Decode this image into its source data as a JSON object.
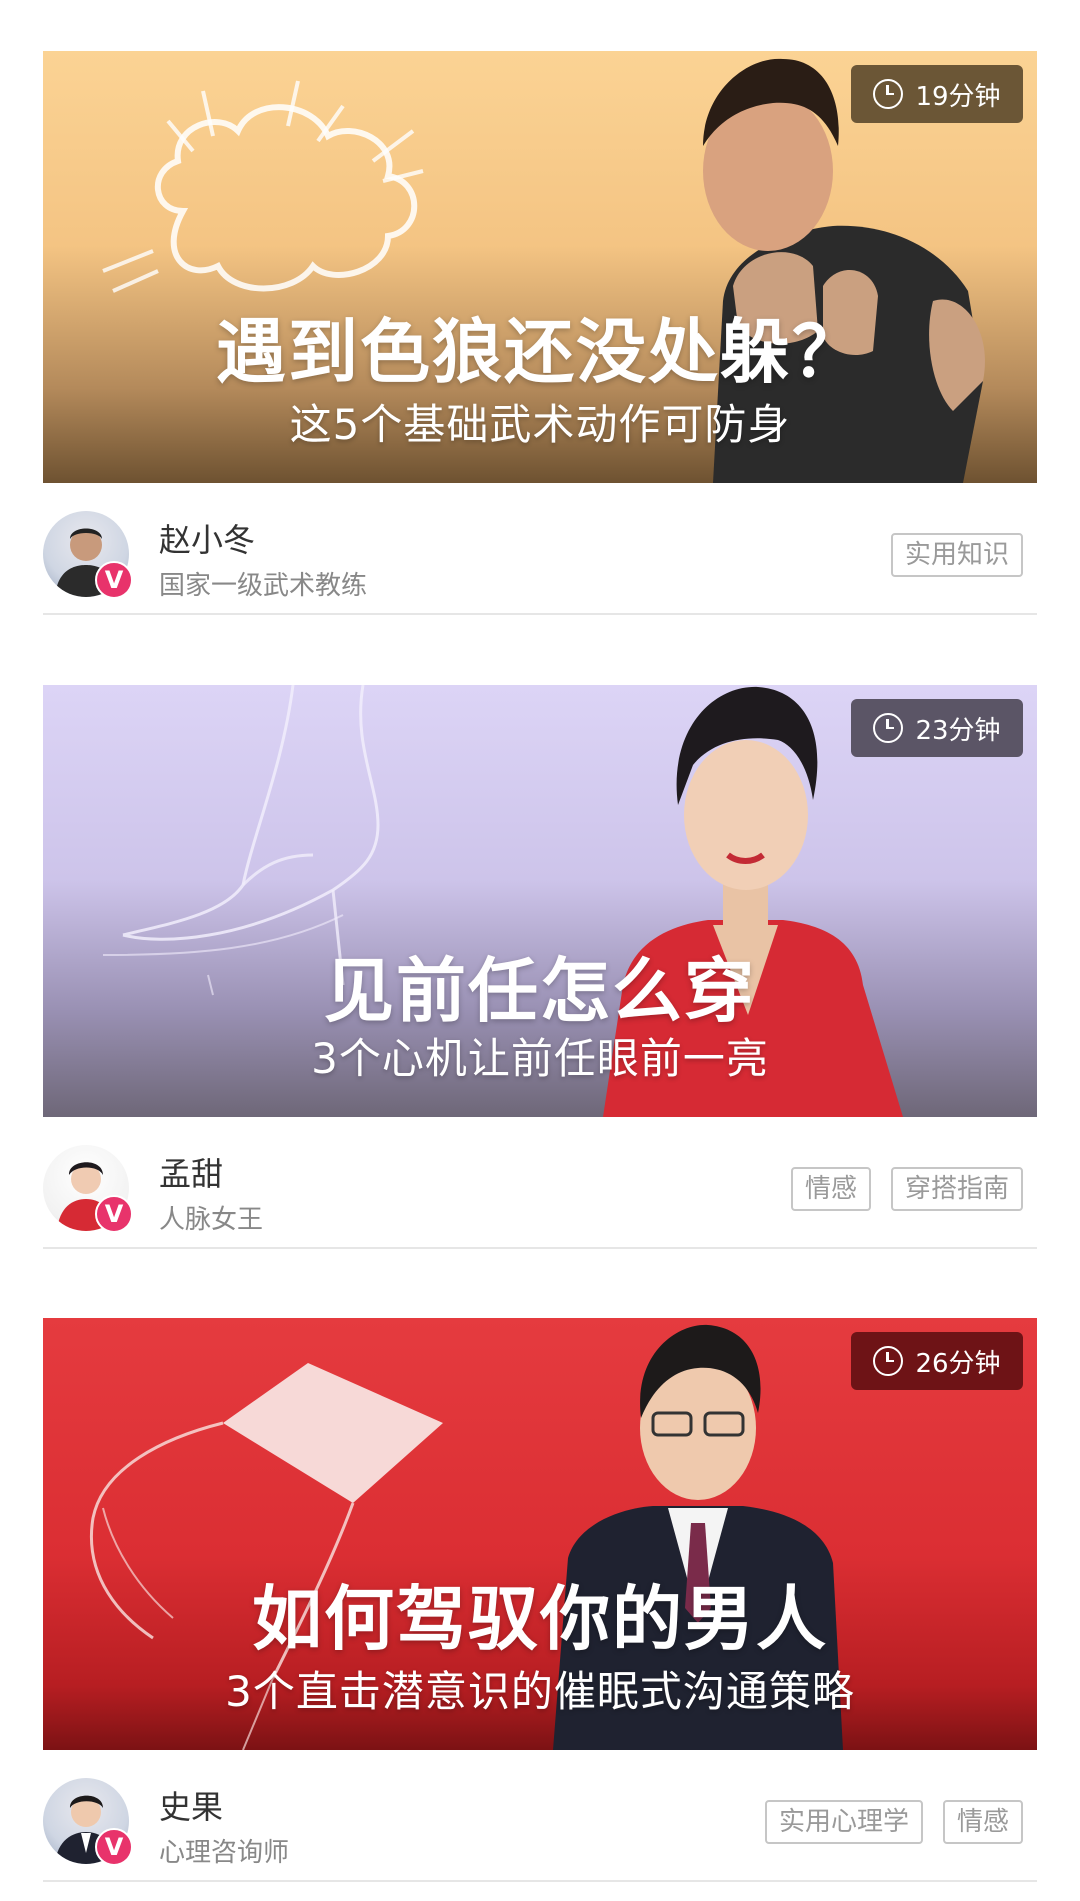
{
  "feed": {
    "cards": [
      {
        "duration": "19分钟",
        "title": "遇到色狼还没处躲？",
        "subtitle": "这5个基础武术动作可防身",
        "author": "赵小冬",
        "role": "国家一级武术教练",
        "badge": "V",
        "tags": [
          "实用知识"
        ],
        "duration_bg": "#6b5636"
      },
      {
        "duration": "23分钟",
        "title": "见前任怎么穿",
        "subtitle": "3个心机让前任眼前一亮",
        "author": "孟甜",
        "role": "人脉女王",
        "badge": "V",
        "tags": [
          "情感",
          "穿搭指南"
        ],
        "duration_bg": "#5b5566"
      },
      {
        "duration": "26分钟",
        "title": "如何驾驭你的男人",
        "subtitle": "3个直击潜意识的催眠式沟通策略",
        "author": "史果",
        "role": "心理咨询师",
        "badge": "V",
        "tags": [
          "实用心理学",
          "情感"
        ],
        "duration_bg": "#6e1316"
      }
    ]
  },
  "colors": {
    "badge": "#e8336b",
    "tag_border": "#c6c6c6",
    "divider": "#e6e6e6"
  },
  "icons": {
    "duration": "clock-icon",
    "verified": "verified-v-badge"
  }
}
